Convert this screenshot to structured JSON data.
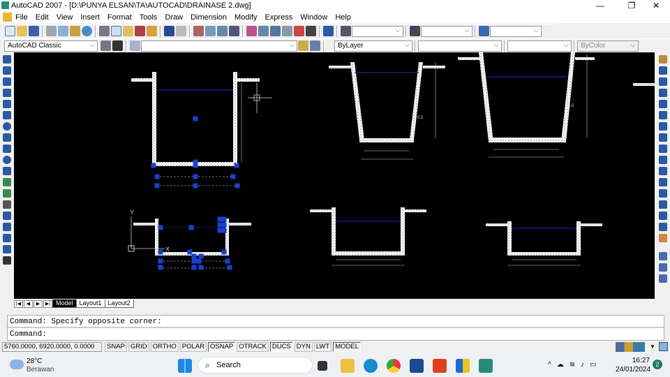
{
  "window": {
    "title": "AutoCAD 2007 - [D:\\PUNYA ELSAN\\TA\\AUTOCAD\\DRAINASE 2.dwg]",
    "minimize": "—",
    "restore": "❐",
    "close": "✕"
  },
  "menu": [
    "File",
    "Edit",
    "View",
    "Insert",
    "Format",
    "Tools",
    "Draw",
    "Dimension",
    "Modify",
    "Express",
    "Window",
    "Help"
  ],
  "toolbar": {
    "workspace": "AutoCAD Classic",
    "layer": "",
    "text_style": "",
    "dim_style": "",
    "table_style": "",
    "color": "ByLayer",
    "linetype": "",
    "lineweight": "",
    "plot_style": "ByColor"
  },
  "drawing": {
    "slope_label_1": "0.5",
    "slope_label_2": "0.5",
    "ucs_y": "Y",
    "ucs_x": "X"
  },
  "tabs": {
    "items": [
      "Model",
      "Layout1",
      "Layout2"
    ],
    "active": "Model",
    "nav": [
      "|◀",
      "◀",
      "▶",
      "▶|"
    ]
  },
  "command": {
    "history": "Command: Specify opposite corner:",
    "prompt": "Command:"
  },
  "status": {
    "coords": "5760.0000, 6920.0000, 0.0000",
    "buttons": [
      {
        "label": "SNAP",
        "on": false
      },
      {
        "label": "GRID",
        "on": false
      },
      {
        "label": "ORTHO",
        "on": false
      },
      {
        "label": "POLAR",
        "on": false
      },
      {
        "label": "OSNAP",
        "on": true
      },
      {
        "label": "OTRACK",
        "on": false
      },
      {
        "label": "DUCS",
        "on": true
      },
      {
        "label": "DYN",
        "on": false
      },
      {
        "label": "LWT",
        "on": false
      },
      {
        "label": "MODEL",
        "on": true
      }
    ]
  },
  "taskbar": {
    "weather_temp": "28°C",
    "weather_desc": "Berawan",
    "search": "Search",
    "time": "16:27",
    "date": "24/01/2024",
    "notifications": "2"
  },
  "colors": {
    "grip": "#1a3fd0",
    "water_line": "#1c1c9c",
    "canvas": "#000000"
  }
}
